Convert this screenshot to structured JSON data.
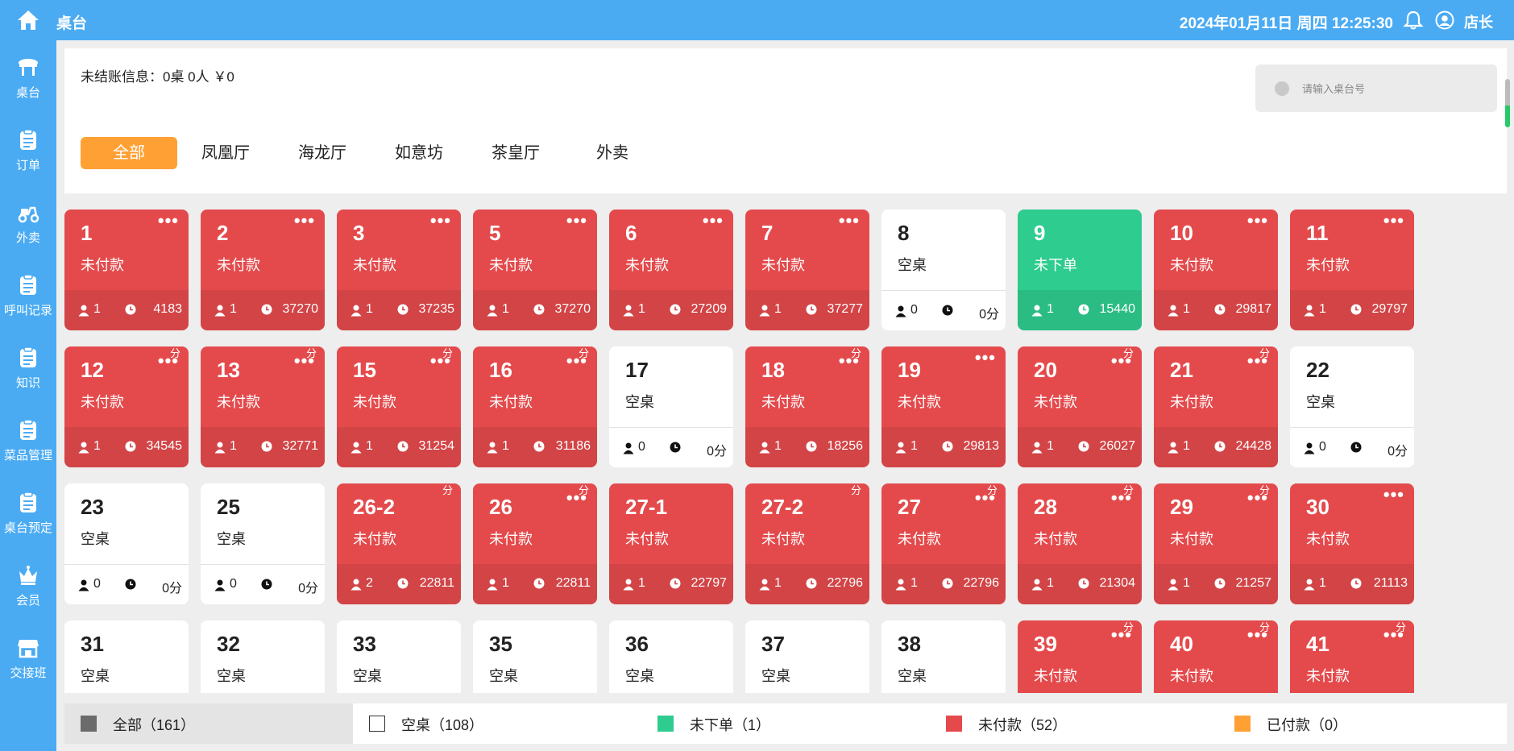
{
  "header": {
    "title": "桌台",
    "datetime": "2024年01月11日 周四 12:25:30",
    "user": "店长"
  },
  "sidebar": {
    "items": [
      {
        "label": "桌台",
        "icon": "table-icon"
      },
      {
        "label": "订单",
        "icon": "clipboard-icon"
      },
      {
        "label": "外卖",
        "icon": "scooter-icon"
      },
      {
        "label": "呼叫记录",
        "icon": "clipboard-icon"
      },
      {
        "label": "知识",
        "icon": "clipboard-icon"
      },
      {
        "label": "菜品管理",
        "icon": "clipboard-icon"
      },
      {
        "label": "桌台预定",
        "icon": "clipboard-icon"
      },
      {
        "label": "会员",
        "icon": "crown-icon"
      },
      {
        "label": "交接班",
        "icon": "store-icon"
      }
    ]
  },
  "summary": {
    "unpaid_info": "未结账信息：0桌 0人 ￥0"
  },
  "search": {
    "placeholder": "请输入桌台号"
  },
  "tabs": [
    {
      "label": "全部",
      "active": true
    },
    {
      "label": "凤凰厅",
      "active": false
    },
    {
      "label": "海龙厅",
      "active": false
    },
    {
      "label": "如意坊",
      "active": false
    },
    {
      "label": "茶皇厅",
      "active": false
    },
    {
      "label": "外卖",
      "active": false
    }
  ],
  "colors": {
    "unpaid": "#e44a4c",
    "unordered": "#2ecc8f",
    "paid": "#ffa035",
    "empty": "#ffffff",
    "accent": "#4aabf3"
  },
  "tables": [
    {
      "num": "1",
      "status": "未付款",
      "kind": "unpaid",
      "guests": "1",
      "elapsed": "4183",
      "dots": true,
      "fen": false
    },
    {
      "num": "2",
      "status": "未付款",
      "kind": "unpaid",
      "guests": "1",
      "elapsed": "37270",
      "dots": true,
      "fen": false
    },
    {
      "num": "3",
      "status": "未付款",
      "kind": "unpaid",
      "guests": "1",
      "elapsed": "37235",
      "dots": true,
      "fen": false
    },
    {
      "num": "5",
      "status": "未付款",
      "kind": "unpaid",
      "guests": "1",
      "elapsed": "37270",
      "dots": true,
      "fen": false
    },
    {
      "num": "6",
      "status": "未付款",
      "kind": "unpaid",
      "guests": "1",
      "elapsed": "27209",
      "dots": true,
      "fen": false
    },
    {
      "num": "7",
      "status": "未付款",
      "kind": "unpaid",
      "guests": "1",
      "elapsed": "37277",
      "dots": true,
      "fen": false
    },
    {
      "num": "8",
      "status": "空桌",
      "kind": "empty",
      "guests": "0",
      "elapsed": "0分",
      "dots": false,
      "fen": false
    },
    {
      "num": "9",
      "status": "未下单",
      "kind": "unordered",
      "guests": "1",
      "elapsed": "15440",
      "dots": false,
      "fen": false
    },
    {
      "num": "10",
      "status": "未付款",
      "kind": "unpaid",
      "guests": "1",
      "elapsed": "29817",
      "dots": true,
      "fen": false
    },
    {
      "num": "11",
      "status": "未付款",
      "kind": "unpaid",
      "guests": "1",
      "elapsed": "29797",
      "dots": true,
      "fen": false
    },
    {
      "num": "12",
      "status": "未付款",
      "kind": "unpaid",
      "guests": "1",
      "elapsed": "34545",
      "dots": true,
      "fen": true
    },
    {
      "num": "13",
      "status": "未付款",
      "kind": "unpaid",
      "guests": "1",
      "elapsed": "32771",
      "dots": true,
      "fen": true
    },
    {
      "num": "15",
      "status": "未付款",
      "kind": "unpaid",
      "guests": "1",
      "elapsed": "31254",
      "dots": true,
      "fen": true
    },
    {
      "num": "16",
      "status": "未付款",
      "kind": "unpaid",
      "guests": "1",
      "elapsed": "31186",
      "dots": true,
      "fen": true
    },
    {
      "num": "17",
      "status": "空桌",
      "kind": "empty",
      "guests": "0",
      "elapsed": "0分",
      "dots": false,
      "fen": false
    },
    {
      "num": "18",
      "status": "未付款",
      "kind": "unpaid",
      "guests": "1",
      "elapsed": "18256",
      "dots": true,
      "fen": true
    },
    {
      "num": "19",
      "status": "未付款",
      "kind": "unpaid",
      "guests": "1",
      "elapsed": "29813",
      "dots": true,
      "fen": false
    },
    {
      "num": "20",
      "status": "未付款",
      "kind": "unpaid",
      "guests": "1",
      "elapsed": "26027",
      "dots": true,
      "fen": true
    },
    {
      "num": "21",
      "status": "未付款",
      "kind": "unpaid",
      "guests": "1",
      "elapsed": "24428",
      "dots": true,
      "fen": true
    },
    {
      "num": "22",
      "status": "空桌",
      "kind": "empty",
      "guests": "0",
      "elapsed": "0分",
      "dots": false,
      "fen": false
    },
    {
      "num": "23",
      "status": "空桌",
      "kind": "empty",
      "guests": "0",
      "elapsed": "0分",
      "dots": false,
      "fen": false
    },
    {
      "num": "25",
      "status": "空桌",
      "kind": "empty",
      "guests": "0",
      "elapsed": "0分",
      "dots": false,
      "fen": false
    },
    {
      "num": "26-2",
      "status": "未付款",
      "kind": "unpaid",
      "guests": "2",
      "elapsed": "22811",
      "dots": false,
      "fen": true
    },
    {
      "num": "26",
      "status": "未付款",
      "kind": "unpaid",
      "guests": "1",
      "elapsed": "22811",
      "dots": true,
      "fen": true
    },
    {
      "num": "27-1",
      "status": "未付款",
      "kind": "unpaid",
      "guests": "1",
      "elapsed": "22797",
      "dots": false,
      "fen": false
    },
    {
      "num": "27-2",
      "status": "未付款",
      "kind": "unpaid",
      "guests": "1",
      "elapsed": "22796",
      "dots": false,
      "fen": true
    },
    {
      "num": "27",
      "status": "未付款",
      "kind": "unpaid",
      "guests": "1",
      "elapsed": "22796",
      "dots": true,
      "fen": true
    },
    {
      "num": "28",
      "status": "未付款",
      "kind": "unpaid",
      "guests": "1",
      "elapsed": "21304",
      "dots": true,
      "fen": true
    },
    {
      "num": "29",
      "status": "未付款",
      "kind": "unpaid",
      "guests": "1",
      "elapsed": "21257",
      "dots": true,
      "fen": true
    },
    {
      "num": "30",
      "status": "未付款",
      "kind": "unpaid",
      "guests": "1",
      "elapsed": "21113",
      "dots": true,
      "fen": false
    },
    {
      "num": "31",
      "status": "空桌",
      "kind": "empty",
      "guests": "",
      "elapsed": "",
      "dots": false,
      "fen": false
    },
    {
      "num": "32",
      "status": "空桌",
      "kind": "empty",
      "guests": "",
      "elapsed": "",
      "dots": false,
      "fen": false
    },
    {
      "num": "33",
      "status": "空桌",
      "kind": "empty",
      "guests": "",
      "elapsed": "",
      "dots": false,
      "fen": false
    },
    {
      "num": "35",
      "status": "空桌",
      "kind": "empty",
      "guests": "",
      "elapsed": "",
      "dots": false,
      "fen": false
    },
    {
      "num": "36",
      "status": "空桌",
      "kind": "empty",
      "guests": "",
      "elapsed": "",
      "dots": false,
      "fen": false
    },
    {
      "num": "37",
      "status": "空桌",
      "kind": "empty",
      "guests": "",
      "elapsed": "",
      "dots": false,
      "fen": false
    },
    {
      "num": "38",
      "status": "空桌",
      "kind": "empty",
      "guests": "",
      "elapsed": "",
      "dots": false,
      "fen": false
    },
    {
      "num": "39",
      "status": "未付款",
      "kind": "unpaid",
      "guests": "",
      "elapsed": "",
      "dots": true,
      "fen": true
    },
    {
      "num": "40",
      "status": "未付款",
      "kind": "unpaid",
      "guests": "",
      "elapsed": "",
      "dots": true,
      "fen": true
    },
    {
      "num": "41",
      "status": "未付款",
      "kind": "unpaid",
      "guests": "",
      "elapsed": "",
      "dots": true,
      "fen": true
    }
  ],
  "card_labels": {
    "dots": "•••",
    "fen": "分"
  },
  "legend": [
    {
      "label": "全部（161）",
      "color": "#6b6b6b",
      "outline": false
    },
    {
      "label": "空桌（108）",
      "color": "#ffffff",
      "outline": true
    },
    {
      "label": "未下单（1）",
      "color": "#2ecc8f",
      "outline": false
    },
    {
      "label": "未付款（52）",
      "color": "#e44a4c",
      "outline": false
    },
    {
      "label": "已付款（0）",
      "color": "#ffa035",
      "outline": false
    }
  ]
}
